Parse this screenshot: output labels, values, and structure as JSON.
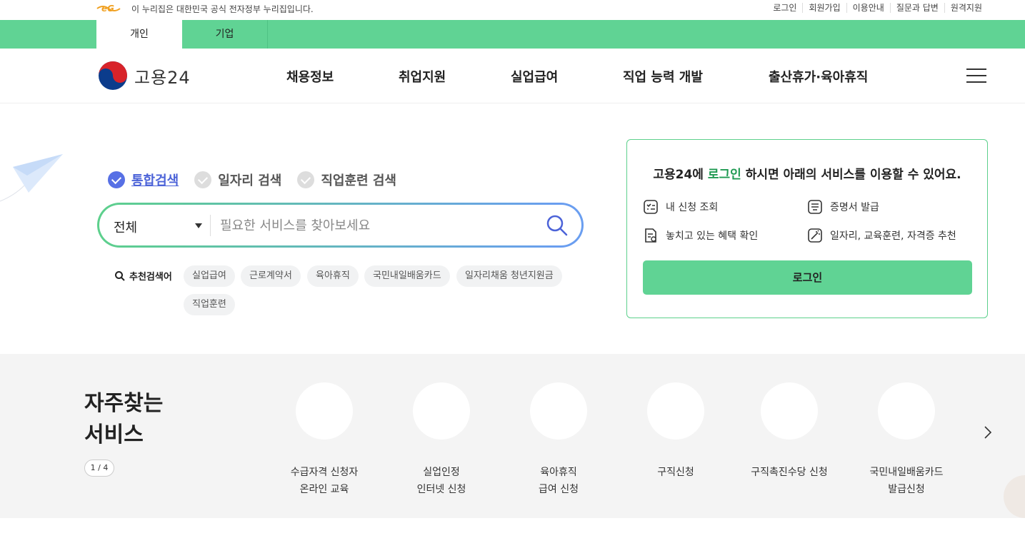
{
  "topbar": {
    "gov_notice": "이 누리집은 대한민국 공식 전자정부 누리집입니다.",
    "links": [
      "로그인",
      "회원가입",
      "이용안내",
      "질문과 답변",
      "원격지원"
    ]
  },
  "tabs": {
    "personal": "개인",
    "corporate": "기업"
  },
  "header": {
    "brand": "고용24",
    "nav": [
      "채용정보",
      "취업지원",
      "실업급여",
      "직업 능력 개발",
      "출산휴가·육아휴직"
    ]
  },
  "search": {
    "tabs": [
      "통합검색",
      "일자리 검색",
      "직업훈련 검색"
    ],
    "category": "전체",
    "placeholder": "필요한 서비스를 찾아보세요",
    "recommended_label": "추천검색어",
    "recommended": [
      "실업급여",
      "근로계약서",
      "육아휴직",
      "국민내일배움카드",
      "일자리채움 청년지원금",
      "직업훈련"
    ]
  },
  "login_panel": {
    "title_pre": "고용24에 ",
    "title_hl": "로그인",
    "title_post": " 하시면 아래의 서비스를 이용할 수 있어요.",
    "services": [
      "내 신청 조회",
      "증명서 발급",
      "놓치고 있는 혜택 확인",
      "일자리, 교육훈련, 자격증 추천"
    ],
    "button": "로그인"
  },
  "frequent": {
    "title_line1": "자주찾는",
    "title_line2": "서비스",
    "pager": "1 / 4",
    "items": [
      "수급자격 신청자\n온라인 교육",
      "실업인정\n인터넷 신청",
      "육아휴직\n급여 신청",
      "구직신청",
      "구직촉진수당 신청",
      "국민내일배움카드\n발급신청"
    ]
  },
  "colors": {
    "accent_green": "#60d394",
    "accent_blue": "#5770e5",
    "highlight_green": "#1f9a52"
  }
}
